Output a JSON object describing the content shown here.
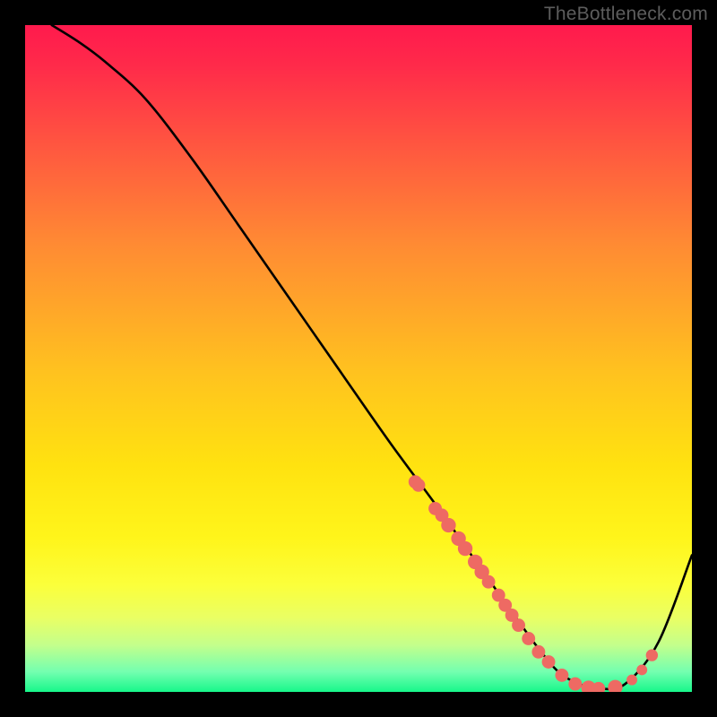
{
  "watermark": "TheBottleneck.com",
  "chart_data": {
    "type": "line",
    "title": "",
    "xlabel": "",
    "ylabel": "",
    "xlim": [
      0,
      100
    ],
    "ylim": [
      0,
      100
    ],
    "series": [
      {
        "name": "curve",
        "x": [
          4,
          8,
          12,
          18,
          25,
          32,
          40,
          48,
          55,
          62,
          68,
          73,
          77,
          80,
          83,
          86,
          90,
          95,
          100
        ],
        "y": [
          100,
          97.5,
          94.5,
          89,
          80,
          70,
          58.5,
          47,
          37,
          27.5,
          19,
          12,
          6.5,
          3,
          1.2,
          0.5,
          1.2,
          7.5,
          20.5
        ]
      }
    ],
    "markers": [
      {
        "x": 58.5,
        "y": 31.5,
        "r": 1.0
      },
      {
        "x": 59.0,
        "y": 31.0,
        "r": 1.0
      },
      {
        "x": 61.5,
        "y": 27.5,
        "r": 1.0
      },
      {
        "x": 62.5,
        "y": 26.5,
        "r": 1.0
      },
      {
        "x": 63.5,
        "y": 25.0,
        "r": 1.1
      },
      {
        "x": 65.0,
        "y": 23.0,
        "r": 1.1
      },
      {
        "x": 66.0,
        "y": 21.5,
        "r": 1.1
      },
      {
        "x": 67.5,
        "y": 19.5,
        "r": 1.1
      },
      {
        "x": 68.5,
        "y": 18.0,
        "r": 1.1
      },
      {
        "x": 69.5,
        "y": 16.5,
        "r": 1.0
      },
      {
        "x": 71.0,
        "y": 14.5,
        "r": 1.0
      },
      {
        "x": 72.0,
        "y": 13.0,
        "r": 1.0
      },
      {
        "x": 73.0,
        "y": 11.5,
        "r": 1.0
      },
      {
        "x": 74.0,
        "y": 10.0,
        "r": 1.0
      },
      {
        "x": 75.5,
        "y": 8.0,
        "r": 1.0
      },
      {
        "x": 77.0,
        "y": 6.0,
        "r": 1.0
      },
      {
        "x": 78.5,
        "y": 4.5,
        "r": 1.0
      },
      {
        "x": 80.5,
        "y": 2.5,
        "r": 1.0
      },
      {
        "x": 82.5,
        "y": 1.2,
        "r": 1.0
      },
      {
        "x": 84.5,
        "y": 0.6,
        "r": 1.1
      },
      {
        "x": 86.0,
        "y": 0.5,
        "r": 1.0
      },
      {
        "x": 88.5,
        "y": 0.7,
        "r": 1.1
      },
      {
        "x": 91.0,
        "y": 1.8,
        "r": 0.8
      },
      {
        "x": 92.5,
        "y": 3.3,
        "r": 0.8
      },
      {
        "x": 94.0,
        "y": 5.5,
        "r": 0.9
      }
    ],
    "colors": {
      "curve_stroke": "#000000",
      "marker_fill": "#ee6a63"
    }
  }
}
